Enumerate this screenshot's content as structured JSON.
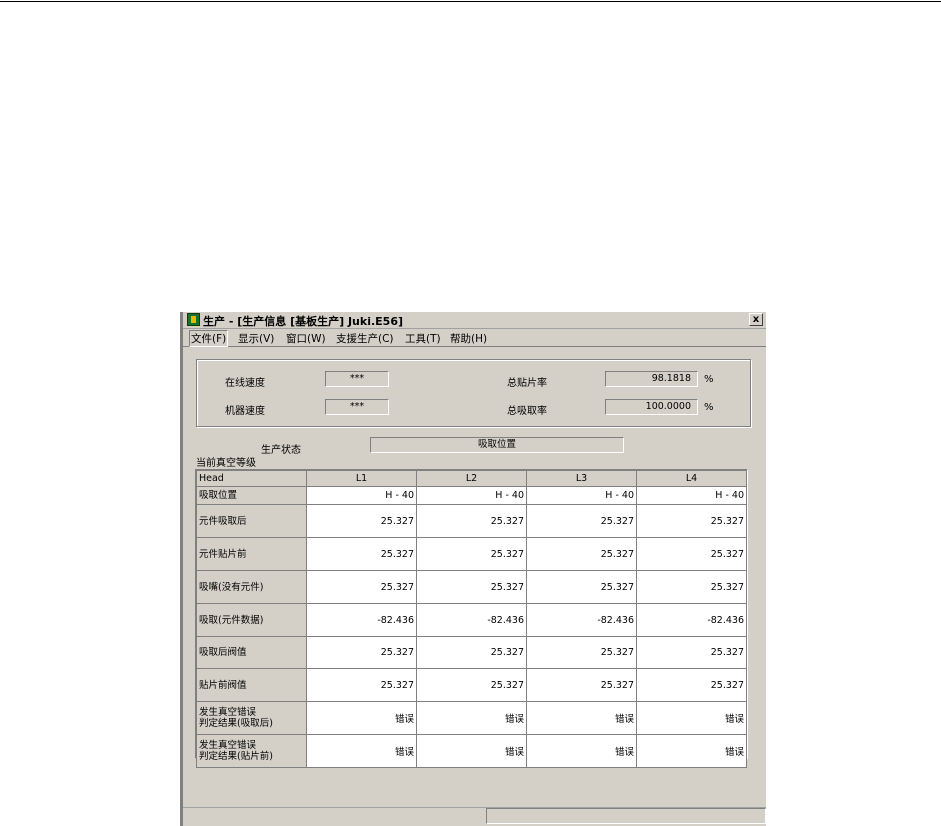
{
  "window": {
    "title": "生产 - [生产信息 [基板生产] Juki.E56]",
    "close_label": "x"
  },
  "menu": [
    "文件(F)",
    "显示(V)",
    "窗口(W)",
    "支援生产(C)",
    "工具(T)",
    "帮助(H)"
  ],
  "speed": {
    "online_label": "在线速度",
    "online_value": "***",
    "machine_label": "机器速度",
    "machine_value": "***"
  },
  "rates": {
    "placement_label": "总贴片率",
    "placement_value": "98.1818",
    "pickup_label": "总吸取率",
    "pickup_value": "100.0000",
    "unit": "%"
  },
  "production_status": {
    "label": "生产状态",
    "value": "吸取位置"
  },
  "vacuum_level_label": "当前真空等级",
  "table": {
    "head_label": "Head",
    "columns": [
      "L1",
      "L2",
      "L3",
      "L4"
    ],
    "rows": [
      {
        "label": "吸取位置",
        "values": [
          "H - 40",
          "H - 40",
          "H - 40",
          "H - 40"
        ]
      },
      {
        "label": "元件吸取后",
        "values": [
          "25.327",
          "25.327",
          "25.327",
          "25.327"
        ]
      },
      {
        "label": "元件贴片前",
        "values": [
          "25.327",
          "25.327",
          "25.327",
          "25.327"
        ]
      },
      {
        "label": "吸嘴(没有元件)",
        "values": [
          "25.327",
          "25.327",
          "25.327",
          "25.327"
        ]
      },
      {
        "label": "吸取(元件数据)",
        "values": [
          "-82.436",
          "-82.436",
          "-82.436",
          "-82.436"
        ]
      },
      {
        "label": "吸取后阀值",
        "values": [
          "25.327",
          "25.327",
          "25.327",
          "25.327"
        ]
      },
      {
        "label": "贴片前阀值",
        "values": [
          "25.327",
          "25.327",
          "25.327",
          "25.327"
        ]
      },
      {
        "label": "发生真空错误\n判定结果(吸取后)",
        "values": [
          "错误",
          "错误",
          "错误",
          "错误"
        ]
      },
      {
        "label": "发生真空错误\n判定结果(贴片前)",
        "values": [
          "错误",
          "错误",
          "错误",
          "错误"
        ]
      }
    ]
  }
}
